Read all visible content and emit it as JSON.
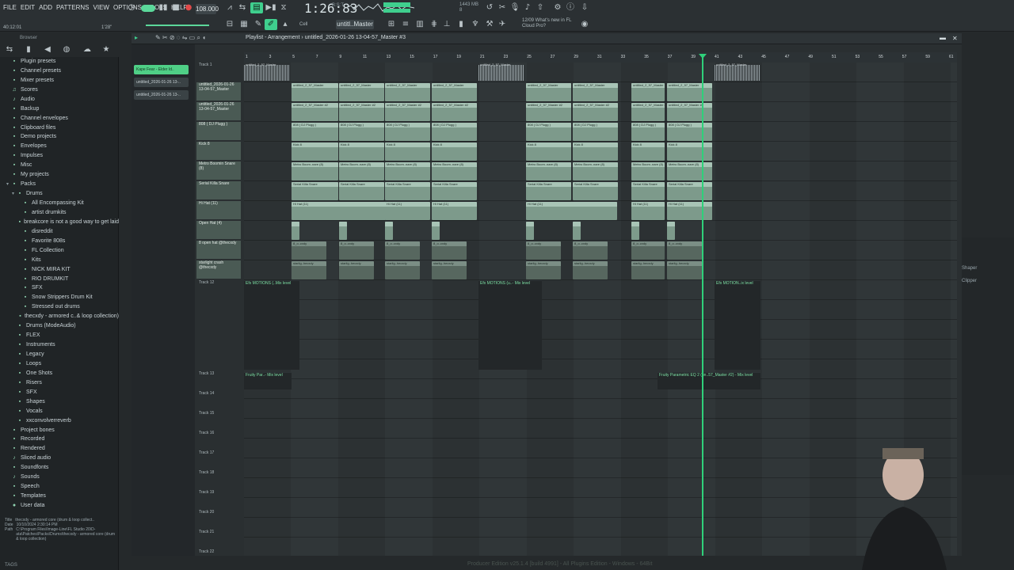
{
  "menu": [
    "FILE",
    "EDIT",
    "ADD",
    "PATTERNS",
    "VIEW",
    "OPTIONS",
    "TOOLS",
    "HELP"
  ],
  "transport": {
    "tempo": "108.000",
    "time": "1:26:83",
    "time_unit": "B:S:T",
    "pattern": "untitl..Master",
    "cell": "Cell",
    "cpu_lines": [
      "1443 MB",
      "8"
    ],
    "news_lines": [
      "12/09 What's new in FL",
      "Cloud Pro?"
    ],
    "pos_readout": "40:12:01",
    "zoom": "1'28\""
  },
  "browser": {
    "title": "Browser",
    "tree": [
      {
        "t": "Plugin presets",
        "lvl": 0,
        "ic": "folder"
      },
      {
        "t": "Channel presets",
        "lvl": 0,
        "ic": "folder"
      },
      {
        "t": "Mixer presets",
        "lvl": 0,
        "ic": "folder"
      },
      {
        "t": "Scores",
        "lvl": 0,
        "ic": "note"
      },
      {
        "t": "Audio",
        "lvl": 0,
        "ic": "audio"
      },
      {
        "t": "Backup",
        "lvl": 0,
        "ic": "folder"
      },
      {
        "t": "Channel envelopes",
        "lvl": 0,
        "ic": "folder"
      },
      {
        "t": "Clipboard files",
        "lvl": 0,
        "ic": "folder"
      },
      {
        "t": "Demo projects",
        "lvl": 0,
        "ic": "folder"
      },
      {
        "t": "Envelopes",
        "lvl": 0,
        "ic": "folder"
      },
      {
        "t": "Impulses",
        "lvl": 0,
        "ic": "folder"
      },
      {
        "t": "Misc",
        "lvl": 0,
        "ic": "folder"
      },
      {
        "t": "My projects",
        "lvl": 0,
        "ic": "folder"
      },
      {
        "t": "Packs",
        "lvl": 0,
        "ic": "folder",
        "open": true
      },
      {
        "t": "Drums",
        "lvl": 1,
        "ic": "folder",
        "open": true
      },
      {
        "t": "All Encompassing Kit",
        "lvl": 2,
        "ic": "folder"
      },
      {
        "t": "artist drumkits",
        "lvl": 2,
        "ic": "folder"
      },
      {
        "t": "breakcore is not a good way to get laid",
        "lvl": 2,
        "ic": "folder"
      },
      {
        "t": "disreddit",
        "lvl": 2,
        "ic": "folder"
      },
      {
        "t": "Favorite 808s",
        "lvl": 2,
        "ic": "folder"
      },
      {
        "t": "FL Collection",
        "lvl": 2,
        "ic": "folder"
      },
      {
        "t": "Kits",
        "lvl": 2,
        "ic": "folder"
      },
      {
        "t": "NICK MIRA KIT",
        "lvl": 2,
        "ic": "folder"
      },
      {
        "t": "RIO DRUMKIT",
        "lvl": 2,
        "ic": "folder"
      },
      {
        "t": "SFX",
        "lvl": 2,
        "ic": "folder"
      },
      {
        "t": "Snow Strippers Drum Kit",
        "lvl": 2,
        "ic": "folder"
      },
      {
        "t": "Stressed out drums",
        "lvl": 2,
        "ic": "folder"
      },
      {
        "t": "thecxdy - armored c..& loop collection)",
        "lvl": 2,
        "ic": "folder"
      },
      {
        "t": "Drums (ModeAudio)",
        "lvl": 1,
        "ic": "folder"
      },
      {
        "t": "FLEX",
        "lvl": 1,
        "ic": "folder"
      },
      {
        "t": "Instruments",
        "lvl": 1,
        "ic": "folder"
      },
      {
        "t": "Legacy",
        "lvl": 1,
        "ic": "folder"
      },
      {
        "t": "Loops",
        "lvl": 1,
        "ic": "folder"
      },
      {
        "t": "One Shots",
        "lvl": 1,
        "ic": "folder"
      },
      {
        "t": "Risers",
        "lvl": 1,
        "ic": "folder"
      },
      {
        "t": "SFX",
        "lvl": 1,
        "ic": "folder"
      },
      {
        "t": "Shapes",
        "lvl": 1,
        "ic": "folder"
      },
      {
        "t": "Vocals",
        "lvl": 1,
        "ic": "folder"
      },
      {
        "t": "xxconvolverreverb",
        "lvl": 1,
        "ic": "folder"
      },
      {
        "t": "Project bones",
        "lvl": 0,
        "ic": "folder"
      },
      {
        "t": "Recorded",
        "lvl": 0,
        "ic": "folder"
      },
      {
        "t": "Rendered",
        "lvl": 0,
        "ic": "folder"
      },
      {
        "t": "Sliced audio",
        "lvl": 0,
        "ic": "audio"
      },
      {
        "t": "Soundfonts",
        "lvl": 0,
        "ic": "folder"
      },
      {
        "t": "Sounds",
        "lvl": 0,
        "ic": "audio"
      },
      {
        "t": "Speech",
        "lvl": 0,
        "ic": "folder"
      },
      {
        "t": "Templates",
        "lvl": 0,
        "ic": "folder"
      },
      {
        "t": "User data",
        "lvl": 0,
        "ic": "user"
      }
    ],
    "info": {
      "title_k": "Title",
      "title_v": "thecxdy - armored core (drum & loop collect..",
      "date_k": "Date",
      "date_v": "10/10/2024 2:30:14 PM",
      "path_k": "Path",
      "path_v": "C:\\Program Files\\Image-Line\\FL Studio 20\\D-ata\\Patches\\Packs\\Drums\\thecxdy - armored core (drum & loop collection)"
    },
    "tags": "TAGS"
  },
  "playlist": {
    "title": "Playlist - Arrangement",
    "song": "untitled_2026-01-26 13-04-57_Master #3",
    "picker": [
      "Kape Fear - Elder Id..",
      "untitled_2026-01-26 13-..",
      "untitled_2026-01-26 13-.."
    ],
    "ruler": [
      "1",
      "3",
      "5",
      "7",
      "9",
      "11",
      "13",
      "15",
      "17",
      "19",
      "21",
      "23",
      "25",
      "27",
      "29",
      "31",
      "33",
      "35",
      "37",
      "39",
      "41",
      "43",
      "45",
      "47",
      "49",
      "51",
      "53",
      "55",
      "57",
      "59",
      "61"
    ],
    "tracks": [
      "Track 1",
      "untitled_2026-01-26 13-04-57_Master",
      "untitled_2026-01-26 13-04-57_Master",
      "808 ( DJ Plugg )",
      "Kick 8",
      "Metro Boomin Snare (8)",
      "Serial Killa Snare",
      "Hi Hat (11)",
      "Open Hat (4)",
      "8 open hat @thecxdy",
      "starlight crash @thecxdy",
      "Track 12",
      "Track 13",
      "Track 14",
      "Track 15",
      "Track 16",
      "Track 17",
      "Track 18",
      "Track 19",
      "Track 20",
      "Track 21",
      "Track 22"
    ],
    "clip_labels": {
      "t1": "untitled_2_57_Master",
      "t2": "untitled_2_57_Master",
      "t3": "untitled_2_57_Master #2",
      "t4": "808 ( DJ Plugg )",
      "t5": "Kick 8",
      "t6": "Metro Boom..nare (8)",
      "t7": "Serial Killa Snare",
      "t8": "Hi Hat (11)",
      "t9": "",
      "t10": "8_o..cxdy",
      "t11": "starlig..hecxdy"
    },
    "auto12": [
      "Efx MOTIONS (..Mix level",
      "Efx MOTIONS (u..- Mix level",
      "Efx MOTION..ix level"
    ],
    "auto13": [
      "Fruity Par..- Mix level",
      "Fruity Parametric EQ 2 (un..57_Master #2) - Mix level"
    ]
  },
  "right": {
    "labels": [
      "Shaper",
      "Clipper"
    ]
  },
  "status": "Producer Edition v25.1.4 [build 4991] - All Plugins Edition - Windows - 64Bit",
  "colors": {
    "accent": "#2fd07a",
    "clip": "#7d9a8b",
    "playhead": "#2fd07a"
  }
}
